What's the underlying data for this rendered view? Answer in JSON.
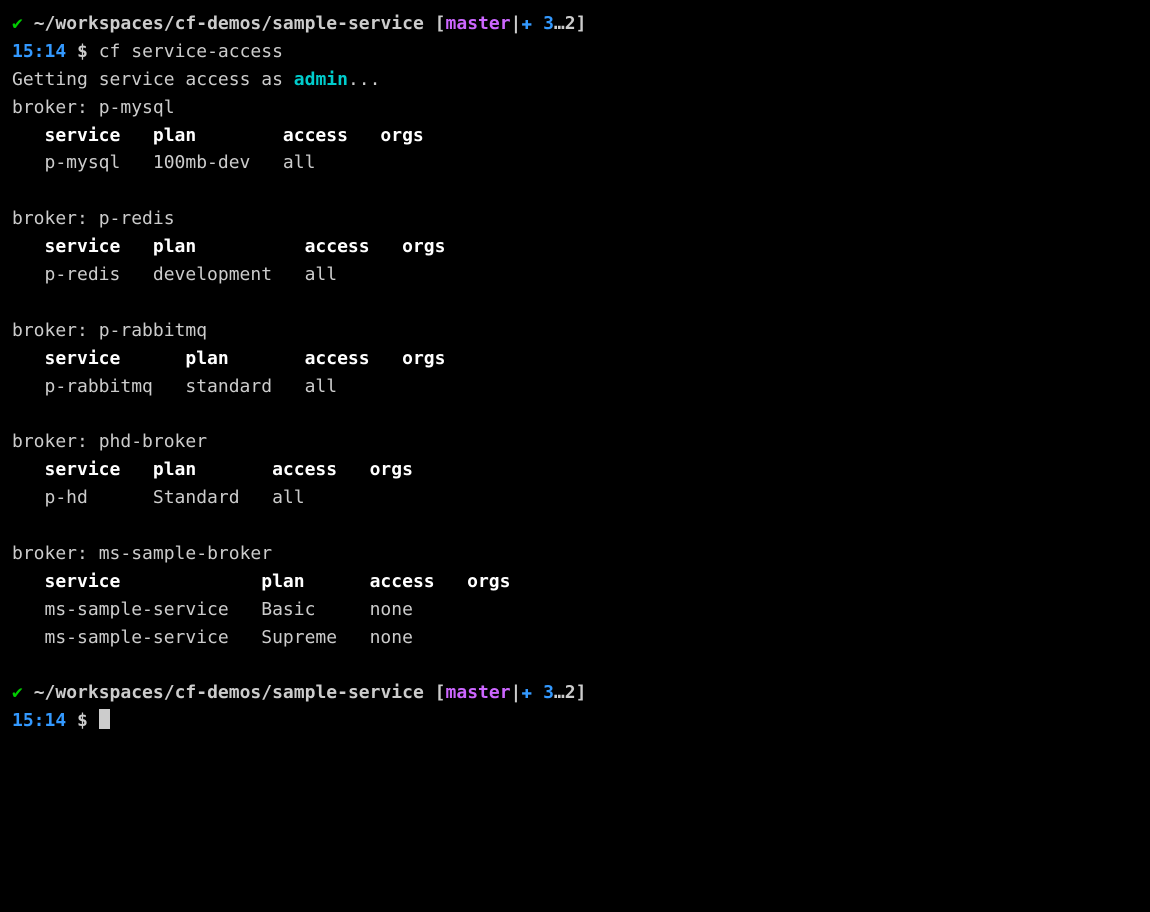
{
  "prompt1": {
    "check": "✔",
    "path": "~/workspaces/cf-demos/sample-service",
    "bracket_open": "[",
    "branch": "master",
    "pipe": "|",
    "plus": "✚",
    "num1": "3",
    "dots": "…",
    "num2": "2",
    "bracket_close": "]",
    "time": "15:14",
    "dollar": "$",
    "command": "cf service-access"
  },
  "status": {
    "prefix": "Getting service access as ",
    "user": "admin",
    "suffix": "..."
  },
  "headers": {
    "service": "service",
    "plan": "plan",
    "access": "access",
    "orgs": "orgs"
  },
  "broker_prefix": "broker: ",
  "brokers": [
    {
      "name": "p-mysql",
      "cols": [
        10,
        12,
        9,
        8
      ],
      "rows": [
        {
          "service": "p-mysql",
          "plan": "100mb-dev",
          "access": "all",
          "orgs": ""
        }
      ]
    },
    {
      "name": "p-redis",
      "cols": [
        10,
        14,
        9,
        8
      ],
      "rows": [
        {
          "service": "p-redis",
          "plan": "development",
          "access": "all",
          "orgs": ""
        }
      ]
    },
    {
      "name": "p-rabbitmq",
      "cols": [
        13,
        11,
        9,
        8
      ],
      "rows": [
        {
          "service": "p-rabbitmq",
          "plan": "standard",
          "access": "all",
          "orgs": ""
        }
      ]
    },
    {
      "name": "phd-broker",
      "cols": [
        10,
        11,
        9,
        8
      ],
      "rows": [
        {
          "service": "p-hd",
          "plan": "Standard",
          "access": "all",
          "orgs": ""
        }
      ]
    },
    {
      "name": "ms-sample-broker",
      "cols": [
        20,
        10,
        9,
        8
      ],
      "rows": [
        {
          "service": "ms-sample-service",
          "plan": "Basic",
          "access": "none",
          "orgs": ""
        },
        {
          "service": "ms-sample-service",
          "plan": "Supreme",
          "access": "none",
          "orgs": ""
        }
      ]
    }
  ],
  "prompt2": {
    "check": "✔",
    "path": "~/workspaces/cf-demos/sample-service",
    "bracket_open": "[",
    "branch": "master",
    "pipe": "|",
    "plus": "✚",
    "num1": "3",
    "dots": "…",
    "num2": "2",
    "bracket_close": "]",
    "time": "15:14",
    "dollar": "$"
  }
}
